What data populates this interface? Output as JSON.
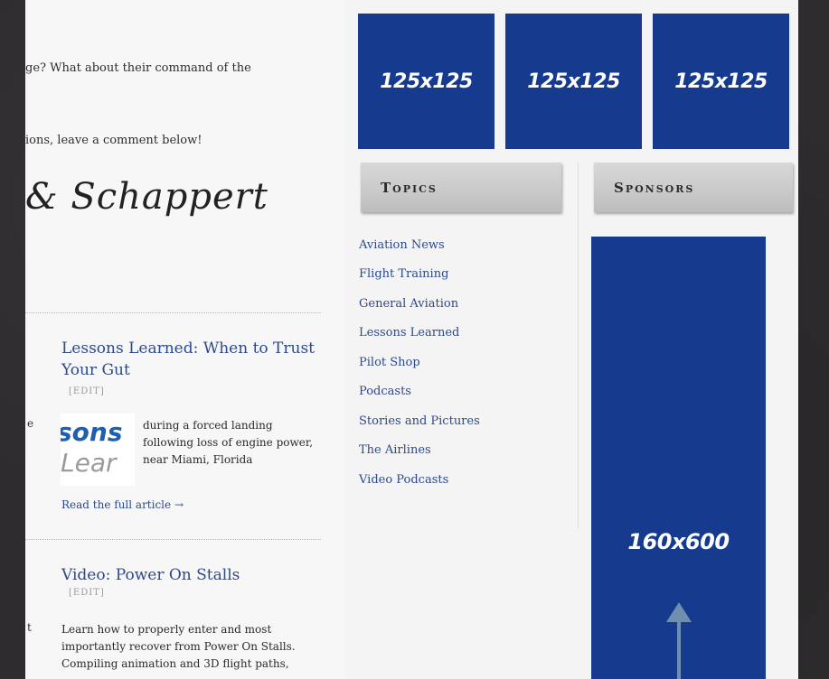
{
  "main": {
    "line1": "ge? What about their command of the",
    "line2": "ions, leave a comment below!",
    "signature": "& Schappert",
    "posts": [
      {
        "title_line1": "Lessons Learned: When to Trust",
        "title_line2": "Your Gut",
        "edit": "[EDIT]",
        "stray": "e",
        "thumb_top": "sons",
        "thumb_bottom": "Lear",
        "excerpt": [
          "during a forced landing",
          "following loss of engine power,",
          "near Miami, Florida"
        ],
        "read_more": "Read the full article →"
      },
      {
        "title_line1": "Video: Power On Stalls",
        "edit": "[EDIT]",
        "stray": "t",
        "excerpt": [
          "Learn how to properly enter and most",
          "importantly recover from Power On Stalls.",
          "Compiling animation and 3D flight paths,"
        ]
      }
    ]
  },
  "sidebar": {
    "ads_small": [
      "125x125",
      "125x125",
      "125x125"
    ],
    "topics_heading": "Topics",
    "sponsors_heading": "Sponsors",
    "topics": [
      "Aviation News",
      "Flight Training",
      "General Aviation",
      "Lessons Learned",
      "Pilot Shop",
      "Podcasts",
      "Stories and Pictures",
      "The Airlines",
      "Video Podcasts"
    ],
    "ad_large": "160x600",
    "colors": {
      "ad_blue": "#153a8e",
      "link_blue": "#2c4a8c",
      "arrow": "#6f8fb0"
    },
    "arrow_icon": "up-arrow-icon"
  }
}
